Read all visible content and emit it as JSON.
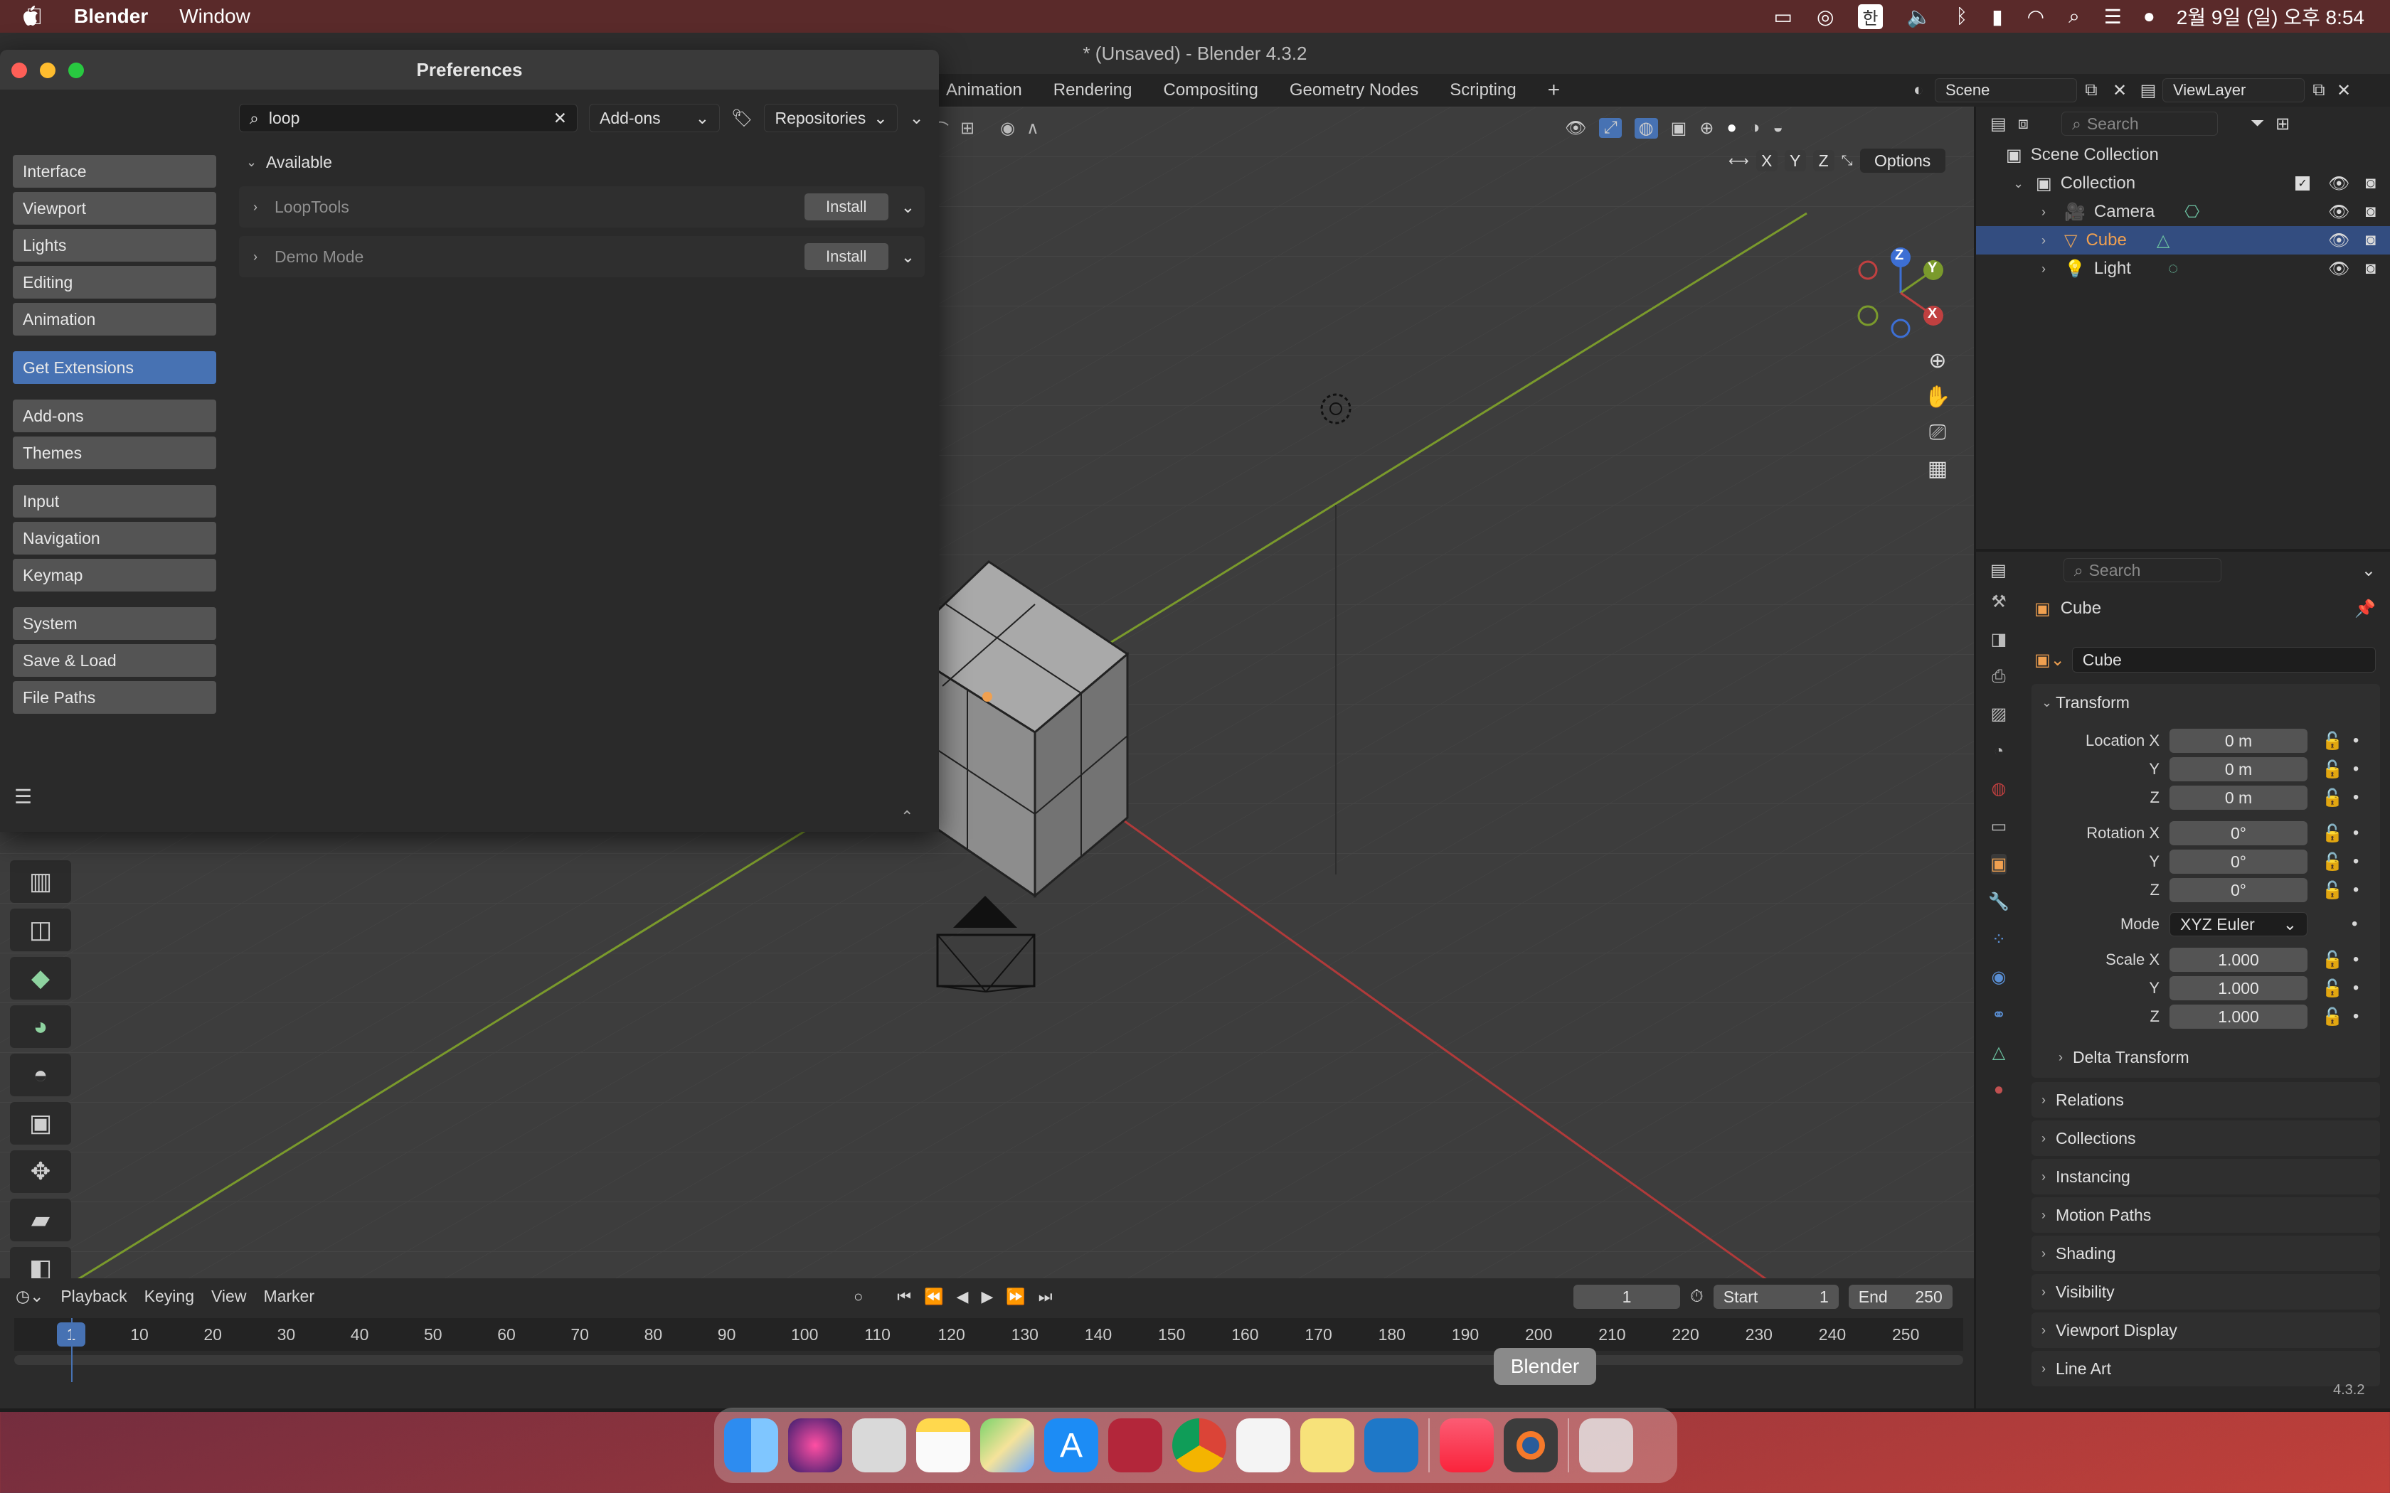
{
  "menubar": {
    "app_name": "Blender",
    "menu_window": "Window",
    "clock": "2월 9일 (일) 오후 8:54",
    "input_method": "한"
  },
  "window": {
    "title": "* (Unsaved) - Blender 4.3.2",
    "workspace_tabs": [
      "Animation",
      "Rendering",
      "Compositing",
      "Geometry Nodes",
      "Scripting"
    ],
    "add_tab": "+",
    "scene": "Scene",
    "view_layer": "ViewLayer",
    "version": "4.3.2"
  },
  "viewport": {
    "options_label": "Options",
    "axis_x": "X",
    "axis_y": "Y",
    "axis_z": "Z",
    "gizmo_x": "X",
    "gizmo_y": "Y",
    "gizmo_z": "Z"
  },
  "outliner": {
    "search_placeholder": "Search",
    "root": "Scene Collection",
    "collection": "Collection",
    "items": [
      {
        "label": "Camera"
      },
      {
        "label": "Cube"
      },
      {
        "label": "Light"
      }
    ]
  },
  "properties": {
    "search_placeholder": "Search",
    "object_name_header": "Cube",
    "object_name_field": "Cube",
    "transform_label": "Transform",
    "location_x_label": "Location X",
    "y_label": "Y",
    "z_label": "Z",
    "location": [
      "0 m",
      "0 m",
      "0 m"
    ],
    "rotation_x_label": "Rotation X",
    "rotation": [
      "0°",
      "0°",
      "0°"
    ],
    "mode_label": "Mode",
    "mode_value": "XYZ Euler",
    "scale_x_label": "Scale X",
    "scale": [
      "1.000",
      "1.000",
      "1.000"
    ],
    "delta_transform": "Delta Transform",
    "panels": [
      "Relations",
      "Collections",
      "Instancing",
      "Motion Paths",
      "Shading",
      "Visibility",
      "Viewport Display",
      "Line Art"
    ]
  },
  "timeline": {
    "menus": [
      "Playback",
      "Keying",
      "View",
      "Marker"
    ],
    "current_frame": "1",
    "start_label": "Start",
    "start_value": "1",
    "end_label": "End",
    "end_value": "250",
    "ruler": [
      "10",
      "20",
      "30",
      "40",
      "50",
      "60",
      "70",
      "80",
      "90",
      "100",
      "110",
      "120",
      "130",
      "140",
      "150",
      "160",
      "170",
      "180",
      "190",
      "200",
      "210",
      "220",
      "230",
      "240",
      "250"
    ],
    "playhead": "1"
  },
  "preferences": {
    "title": "Preferences",
    "nav_groups": [
      [
        "Interface",
        "Viewport",
        "Lights",
        "Editing",
        "Animation"
      ],
      [
        "Get Extensions"
      ],
      [
        "Add-ons",
        "Themes"
      ],
      [
        "Input",
        "Navigation",
        "Keymap"
      ],
      [
        "System",
        "Save & Load",
        "File Paths"
      ]
    ],
    "active_nav": "Get Extensions",
    "search_value": "loop",
    "filter_dropdown": "Add-ons",
    "repositories_dropdown": "Repositories",
    "section_label": "Available",
    "addons": [
      {
        "name": "LoopTools",
        "action": "Install"
      },
      {
        "name": "Demo Mode",
        "action": "Install"
      }
    ]
  },
  "dock": {
    "tooltip": "Blender"
  },
  "colors": {
    "accent": "#4772b3",
    "selected_row": "#334d80",
    "cube_orange": "#f0a050"
  }
}
